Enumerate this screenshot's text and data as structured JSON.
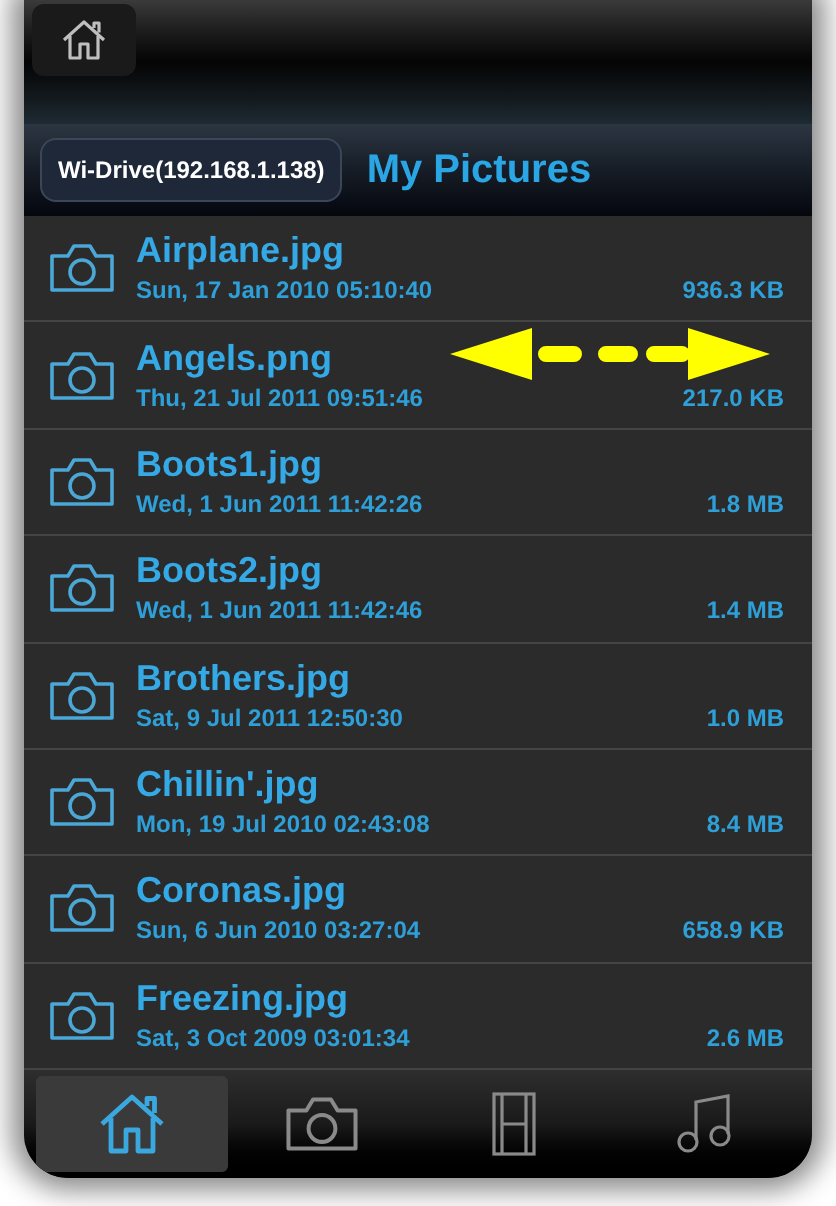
{
  "header": {
    "location_button": "Wi-Drive(192.168.1.138)",
    "title": "My Pictures"
  },
  "files": [
    {
      "name": "Airplane.jpg",
      "date": "Sun, 17 Jan 2010 05:10:40",
      "size": "936.3 KB"
    },
    {
      "name": "Angels.png",
      "date": "Thu, 21 Jul 2011 09:51:46",
      "size": "217.0 KB"
    },
    {
      "name": "Boots1.jpg",
      "date": "Wed, 1 Jun 2011 11:42:26",
      "size": "1.8 MB"
    },
    {
      "name": "Boots2.jpg",
      "date": "Wed, 1 Jun 2011 11:42:46",
      "size": "1.4 MB"
    },
    {
      "name": "Brothers.jpg",
      "date": "Sat, 9 Jul 2011 12:50:30",
      "size": "1.0 MB"
    },
    {
      "name": "Chillin'.jpg",
      "date": "Mon, 19 Jul 2010 02:43:08",
      "size": "8.4 MB"
    },
    {
      "name": "Coronas.jpg",
      "date": "Sun, 6 Jun 2010 03:27:04",
      "size": "658.9 KB"
    },
    {
      "name": "Freezing.jpg",
      "date": "Sat, 3 Oct 2009 03:01:34",
      "size": "2.6 MB"
    }
  ],
  "tabs": [
    {
      "kind": "home",
      "selected": true
    },
    {
      "kind": "camera",
      "selected": false
    },
    {
      "kind": "film",
      "selected": false
    },
    {
      "kind": "music",
      "selected": false
    }
  ]
}
